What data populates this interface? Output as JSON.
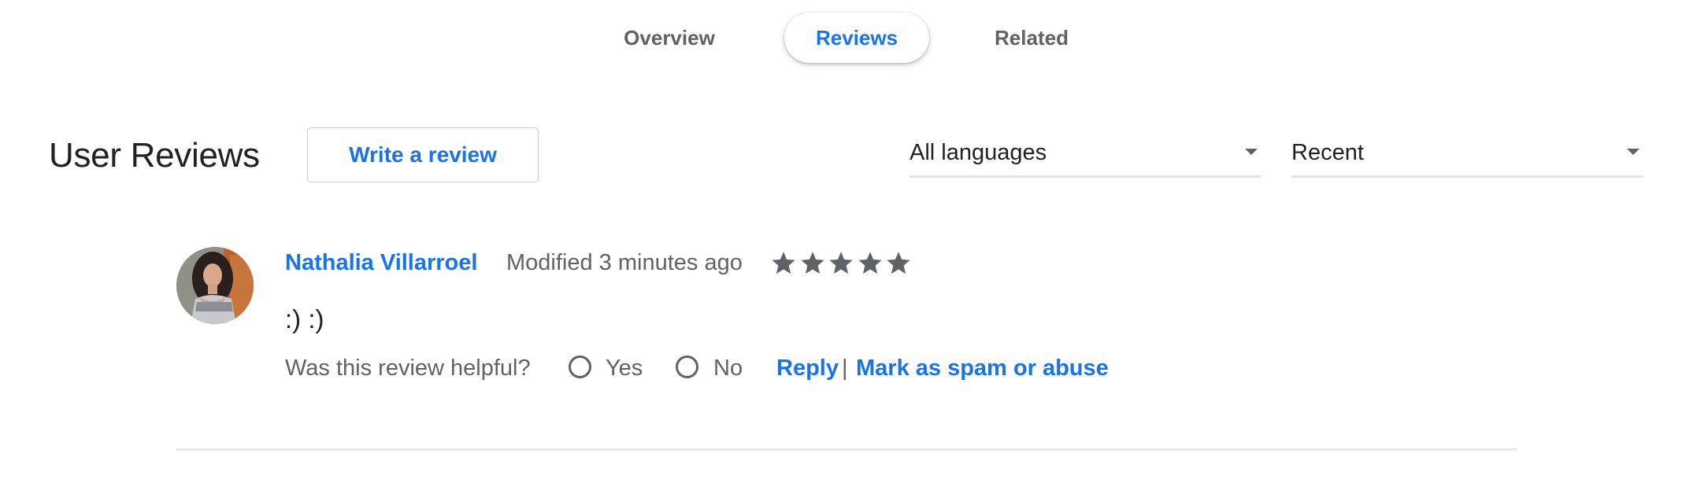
{
  "tabs": [
    {
      "label": "Overview",
      "active": false
    },
    {
      "label": "Reviews",
      "active": true
    },
    {
      "label": "Related",
      "active": false
    }
  ],
  "header": {
    "title": "User Reviews",
    "write_review_label": "Write a review",
    "language_filter": {
      "selected": "All languages",
      "icon": "caret-down-icon"
    },
    "sort_filter": {
      "selected": "Recent",
      "icon": "caret-down-icon"
    }
  },
  "reviews": [
    {
      "author": "Nathalia Villarroel",
      "timestamp": "Modified 3 minutes ago",
      "rating": 5,
      "rating_max": 5,
      "text": ":) :)",
      "helpful_prompt": "Was this review helpful?",
      "yes_label": "Yes",
      "no_label": "No",
      "reply_label": "Reply",
      "separator": "|",
      "spam_label": "Mark as spam or abuse"
    }
  ],
  "colors": {
    "accent": "#1a73e8",
    "text_primary": "#202124",
    "text_secondary": "#5f6368",
    "star": "#5f6368",
    "divider": "#e6e7e9"
  }
}
